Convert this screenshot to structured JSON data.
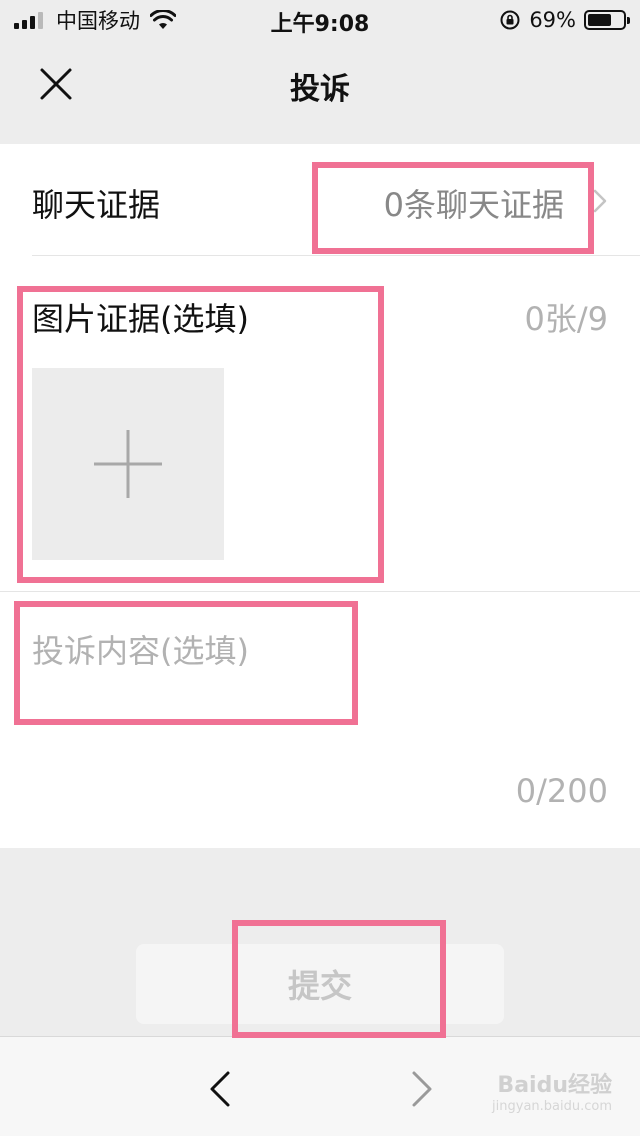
{
  "status_bar": {
    "carrier": "中国移动",
    "time": "上午9:08",
    "battery": "69%",
    "battery_level": 0.69
  },
  "nav": {
    "title": "投诉",
    "close_icon": "close-icon"
  },
  "chat_evidence": {
    "label": "聊天证据",
    "value": "0条聊天证据"
  },
  "image_evidence": {
    "label": "图片证据(选填)",
    "count": "0张/9"
  },
  "complaint_content": {
    "placeholder": "投诉内容(选填)",
    "value": "",
    "count": "0/200"
  },
  "submit": {
    "label": "提交"
  },
  "colors": {
    "annotation": "#f07194",
    "background": "#ededed",
    "card": "#ffffff"
  },
  "watermark": {
    "brand": "Baidu经验",
    "url": "jingyan.baidu.com"
  }
}
